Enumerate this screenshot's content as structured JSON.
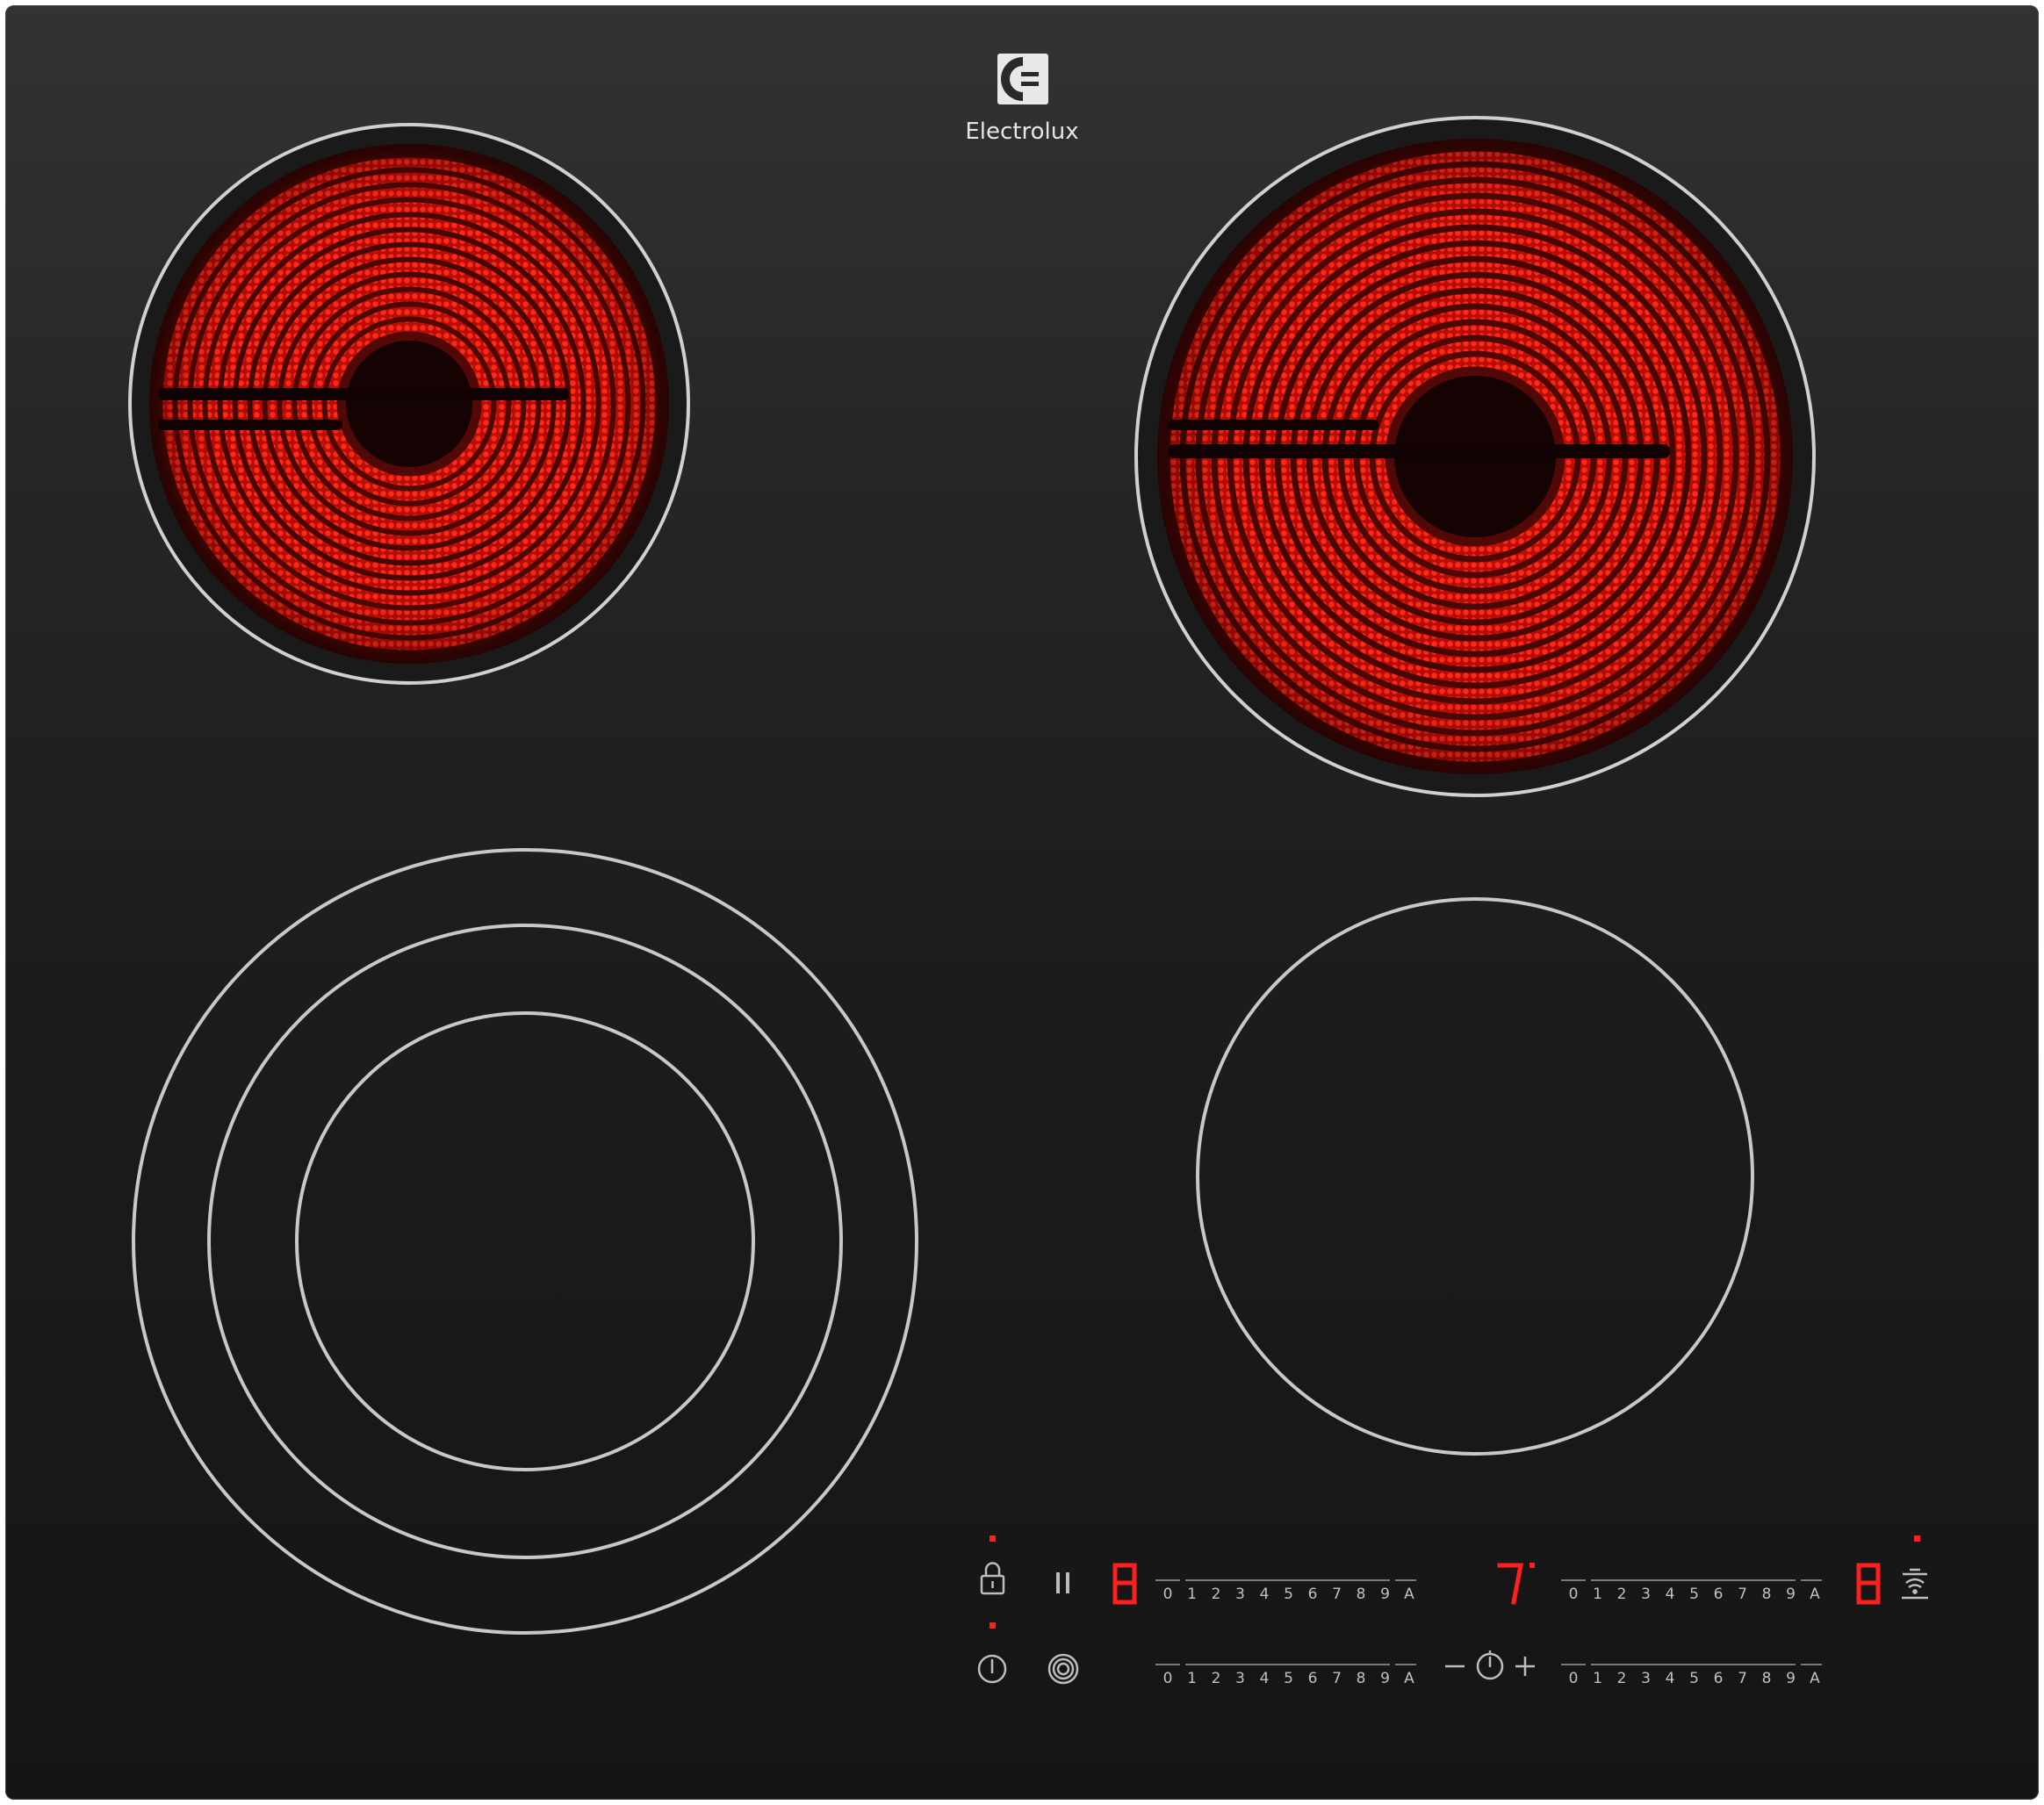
{
  "brand": {
    "name": "Electrolux",
    "logo_icon": "electrolux-logo-icon"
  },
  "colors": {
    "glass_top": "#333333",
    "glass_bottom": "#151515",
    "zone_ring": "#c8c8c8",
    "heat_red": "#ff1a10",
    "led_red": "#ff1f1f",
    "label_gray": "#c0c0c0"
  },
  "zones": [
    {
      "name": "rear-left-zone",
      "state": "heated",
      "rings": 1
    },
    {
      "name": "rear-right-zone",
      "state": "heated",
      "rings": 1
    },
    {
      "name": "front-left-zone",
      "state": "off",
      "rings": 3
    },
    {
      "name": "front-right-zone",
      "state": "off",
      "rings": 1
    }
  ],
  "controls": {
    "displays": {
      "front_left": "8",
      "rear_right": "7",
      "rear_right_dot": ".",
      "hob_hood": "8"
    },
    "slider_scale": [
      "0",
      "1",
      "2",
      "3",
      "4",
      "5",
      "6",
      "7",
      "8",
      "9",
      "A"
    ],
    "timer": {
      "minus": "—",
      "plus": "+"
    },
    "icons": {
      "lock": "lock-icon",
      "pause": "pause-icon",
      "power": "power-icon",
      "zone_select": "zone-select-icon",
      "timer": "timer-icon",
      "hob_hood": "hob-to-hood-icon"
    }
  }
}
